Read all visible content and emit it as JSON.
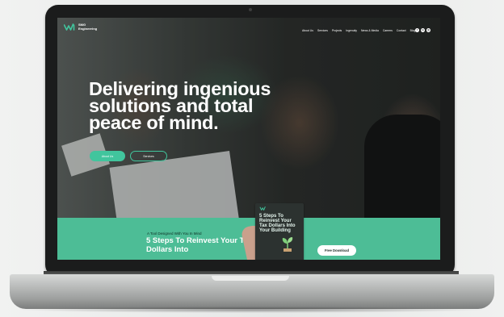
{
  "site": {
    "logo_text": "SMG Engineering",
    "logo_line1": "SMG",
    "logo_line2": "Engineering",
    "brand_color": "#41c59d"
  },
  "nav": {
    "items": [
      "About Us",
      "Services",
      "Projects",
      "Ingenuity",
      "News & Media",
      "Careers",
      "Contact",
      "Blog"
    ],
    "social_icons": [
      "facebook-icon",
      "linkedin-icon",
      "instagram-icon"
    ]
  },
  "hero": {
    "headline": "Delivering ingenious solutions and total peace of mind.",
    "primary_button": "About Us",
    "secondary_button": "Services"
  },
  "banner": {
    "tagline": "A Tool Designed With You In Mind",
    "title": "5 Steps To Reinvest Your Tax Dollars Into",
    "book_title": "5 Steps To Reinvest Your Tax Dollars Into Your Building",
    "download_button": "Free Download",
    "background_color": "#4dbd96"
  }
}
